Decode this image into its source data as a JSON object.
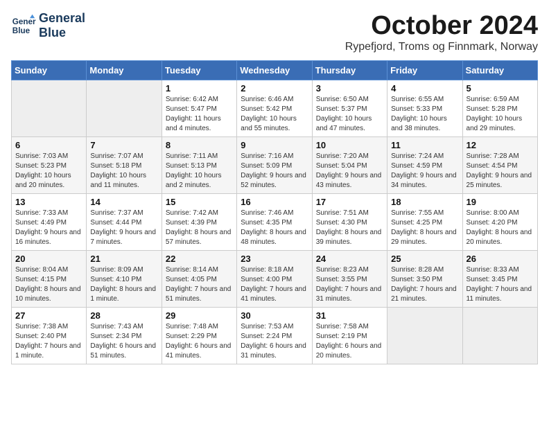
{
  "header": {
    "logo_line1": "General",
    "logo_line2": "Blue",
    "month": "October 2024",
    "location": "Rypefjord, Troms og Finnmark, Norway"
  },
  "weekdays": [
    "Sunday",
    "Monday",
    "Tuesday",
    "Wednesday",
    "Thursday",
    "Friday",
    "Saturday"
  ],
  "weeks": [
    [
      {
        "day": "",
        "info": ""
      },
      {
        "day": "",
        "info": ""
      },
      {
        "day": "1",
        "info": "Sunrise: 6:42 AM\nSunset: 5:47 PM\nDaylight: 11 hours and 4 minutes."
      },
      {
        "day": "2",
        "info": "Sunrise: 6:46 AM\nSunset: 5:42 PM\nDaylight: 10 hours and 55 minutes."
      },
      {
        "day": "3",
        "info": "Sunrise: 6:50 AM\nSunset: 5:37 PM\nDaylight: 10 hours and 47 minutes."
      },
      {
        "day": "4",
        "info": "Sunrise: 6:55 AM\nSunset: 5:33 PM\nDaylight: 10 hours and 38 minutes."
      },
      {
        "day": "5",
        "info": "Sunrise: 6:59 AM\nSunset: 5:28 PM\nDaylight: 10 hours and 29 minutes."
      }
    ],
    [
      {
        "day": "6",
        "info": "Sunrise: 7:03 AM\nSunset: 5:23 PM\nDaylight: 10 hours and 20 minutes."
      },
      {
        "day": "7",
        "info": "Sunrise: 7:07 AM\nSunset: 5:18 PM\nDaylight: 10 hours and 11 minutes."
      },
      {
        "day": "8",
        "info": "Sunrise: 7:11 AM\nSunset: 5:13 PM\nDaylight: 10 hours and 2 minutes."
      },
      {
        "day": "9",
        "info": "Sunrise: 7:16 AM\nSunset: 5:09 PM\nDaylight: 9 hours and 52 minutes."
      },
      {
        "day": "10",
        "info": "Sunrise: 7:20 AM\nSunset: 5:04 PM\nDaylight: 9 hours and 43 minutes."
      },
      {
        "day": "11",
        "info": "Sunrise: 7:24 AM\nSunset: 4:59 PM\nDaylight: 9 hours and 34 minutes."
      },
      {
        "day": "12",
        "info": "Sunrise: 7:28 AM\nSunset: 4:54 PM\nDaylight: 9 hours and 25 minutes."
      }
    ],
    [
      {
        "day": "13",
        "info": "Sunrise: 7:33 AM\nSunset: 4:49 PM\nDaylight: 9 hours and 16 minutes."
      },
      {
        "day": "14",
        "info": "Sunrise: 7:37 AM\nSunset: 4:44 PM\nDaylight: 9 hours and 7 minutes."
      },
      {
        "day": "15",
        "info": "Sunrise: 7:42 AM\nSunset: 4:39 PM\nDaylight: 8 hours and 57 minutes."
      },
      {
        "day": "16",
        "info": "Sunrise: 7:46 AM\nSunset: 4:35 PM\nDaylight: 8 hours and 48 minutes."
      },
      {
        "day": "17",
        "info": "Sunrise: 7:51 AM\nSunset: 4:30 PM\nDaylight: 8 hours and 39 minutes."
      },
      {
        "day": "18",
        "info": "Sunrise: 7:55 AM\nSunset: 4:25 PM\nDaylight: 8 hours and 29 minutes."
      },
      {
        "day": "19",
        "info": "Sunrise: 8:00 AM\nSunset: 4:20 PM\nDaylight: 8 hours and 20 minutes."
      }
    ],
    [
      {
        "day": "20",
        "info": "Sunrise: 8:04 AM\nSunset: 4:15 PM\nDaylight: 8 hours and 10 minutes."
      },
      {
        "day": "21",
        "info": "Sunrise: 8:09 AM\nSunset: 4:10 PM\nDaylight: 8 hours and 1 minute."
      },
      {
        "day": "22",
        "info": "Sunrise: 8:14 AM\nSunset: 4:05 PM\nDaylight: 7 hours and 51 minutes."
      },
      {
        "day": "23",
        "info": "Sunrise: 8:18 AM\nSunset: 4:00 PM\nDaylight: 7 hours and 41 minutes."
      },
      {
        "day": "24",
        "info": "Sunrise: 8:23 AM\nSunset: 3:55 PM\nDaylight: 7 hours and 31 minutes."
      },
      {
        "day": "25",
        "info": "Sunrise: 8:28 AM\nSunset: 3:50 PM\nDaylight: 7 hours and 21 minutes."
      },
      {
        "day": "26",
        "info": "Sunrise: 8:33 AM\nSunset: 3:45 PM\nDaylight: 7 hours and 11 minutes."
      }
    ],
    [
      {
        "day": "27",
        "info": "Sunrise: 7:38 AM\nSunset: 2:40 PM\nDaylight: 7 hours and 1 minute."
      },
      {
        "day": "28",
        "info": "Sunrise: 7:43 AM\nSunset: 2:34 PM\nDaylight: 6 hours and 51 minutes."
      },
      {
        "day": "29",
        "info": "Sunrise: 7:48 AM\nSunset: 2:29 PM\nDaylight: 6 hours and 41 minutes."
      },
      {
        "day": "30",
        "info": "Sunrise: 7:53 AM\nSunset: 2:24 PM\nDaylight: 6 hours and 31 minutes."
      },
      {
        "day": "31",
        "info": "Sunrise: 7:58 AM\nSunset: 2:19 PM\nDaylight: 6 hours and 20 minutes."
      },
      {
        "day": "",
        "info": ""
      },
      {
        "day": "",
        "info": ""
      }
    ]
  ]
}
